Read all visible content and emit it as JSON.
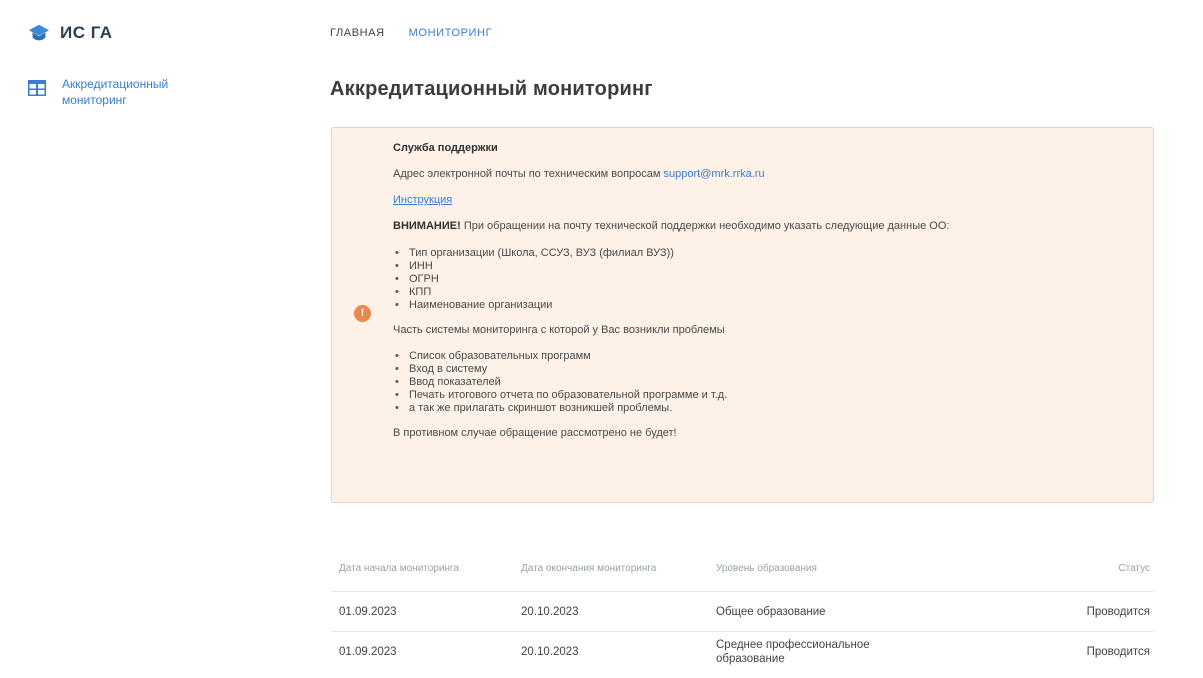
{
  "app": {
    "logo_text": "ИС ГА"
  },
  "topnav": {
    "items": [
      "ГЛАВНАЯ",
      "МОНИТОРИНГ"
    ]
  },
  "sidebar": {
    "items": [
      {
        "label": "Аккредитационный мониторинг",
        "icon": "table-grid-icon"
      }
    ]
  },
  "page": {
    "title": "Аккредитационный мониторинг"
  },
  "support": {
    "title": "Служба поддержки",
    "email_text": "Адрес электронной почты по техническим вопросам",
    "email": "support@mrk.rrka.ru",
    "instruction": "Инструкция",
    "warning_label": "ВНИМАНИЕ!",
    "warning_text": "При обращении на почту технической поддержки необходимо указать следующие данные ОО:",
    "required_data": [
      "Тип организации (Школа, ССУЗ, ВУЗ (филиал ВУЗ))",
      "ИНН",
      "ОГРН",
      "КПП",
      "Наименование организации"
    ],
    "problem_intro": "Часть системы мониторинга с которой у Вас возникли проблемы",
    "problem_parts": [
      "Список образовательных программ",
      "Вход в систему",
      "Ввод показателей",
      "Печать итогового отчета по образовательной программе и т.д.",
      "а так же прилагать скриншот возникшей проблемы."
    ],
    "footer": "В противном случае обращение рассмотрено не будет!",
    "icon": "exclamation-circle-icon",
    "accent_color": "#e8884a"
  },
  "table": {
    "headers": [
      "Дата начала мониторинга",
      "Дата окончания мониторинга",
      "Уровень образования",
      "Статус"
    ],
    "rows": [
      [
        "01.09.2023",
        "20.10.2023",
        "Общее образование",
        "Проводится"
      ],
      [
        "01.09.2023",
        "20.10.2023",
        "Среднее профессиональное образование",
        "Проводится"
      ]
    ]
  }
}
